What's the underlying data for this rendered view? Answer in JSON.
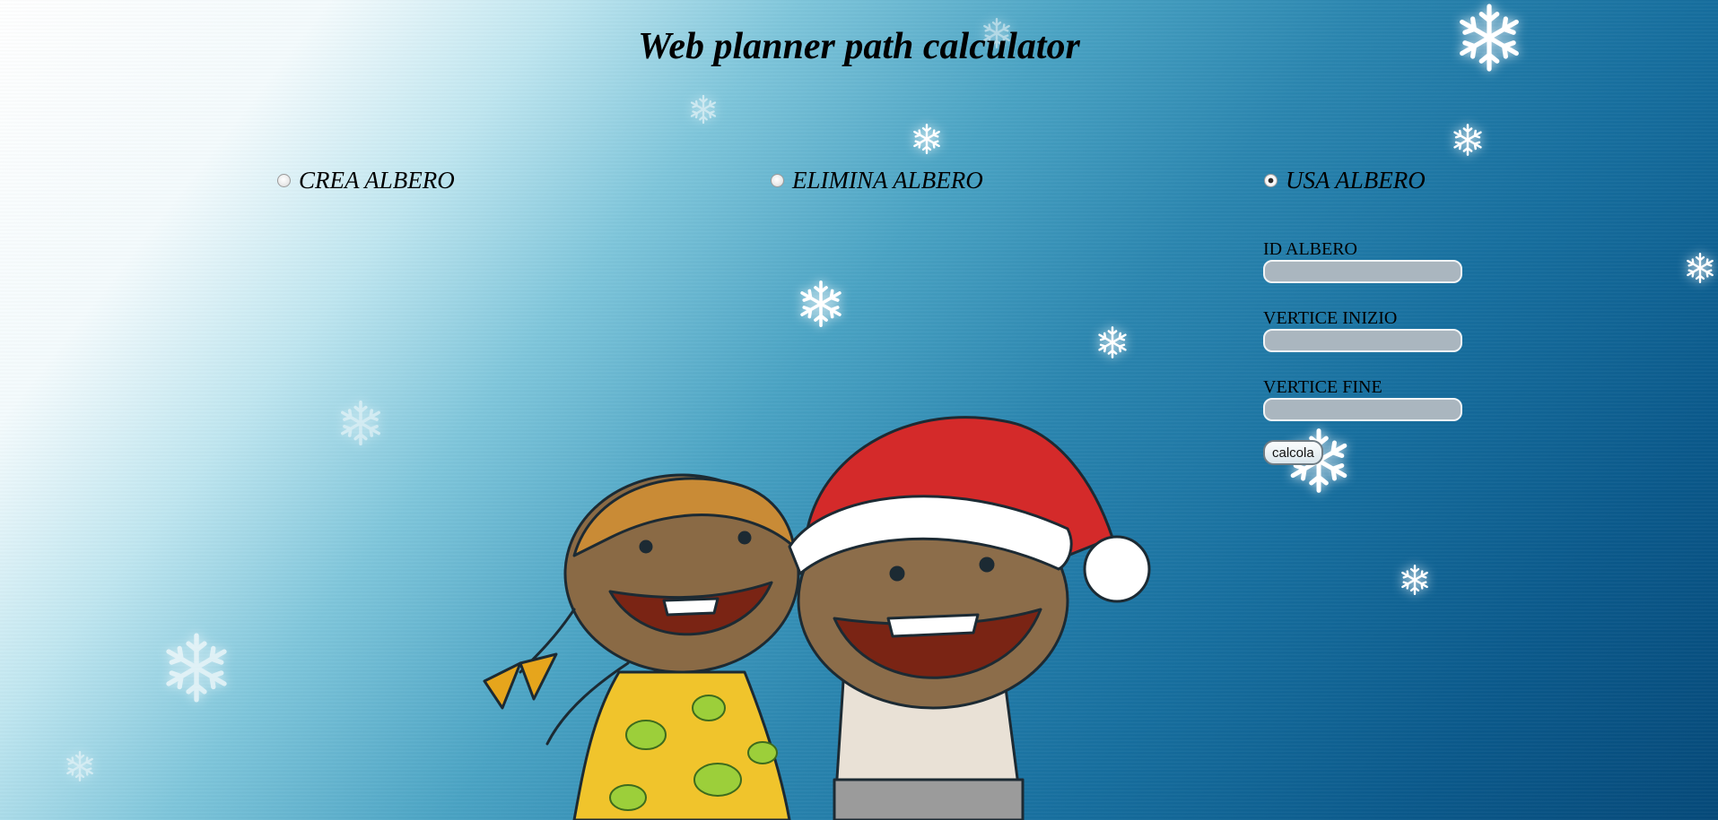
{
  "header": {
    "title": "Web planner path calculator"
  },
  "modes": [
    {
      "label": "CREA ALBERO",
      "value": "crea",
      "checked": false
    },
    {
      "label": "ELIMINA ALBERO",
      "value": "elimina",
      "checked": false
    },
    {
      "label": "USA ALBERO",
      "value": "usa",
      "checked": true
    }
  ],
  "form": {
    "id_label": "ID ALBERO",
    "id_value": "",
    "start_label": "VERTICE INIZIO",
    "start_value": "",
    "end_label": "VERTICE FINE",
    "end_value": "",
    "submit_label": "calcola"
  },
  "theme": {
    "background_light": "#ffffff",
    "background_dark": "#064a7a",
    "input_fill": "#aab6bf",
    "hat_red": "#d42a2a"
  },
  "icons": {
    "snowflake": "snowflake-icon",
    "illustration": "christmas-kids-illustration"
  }
}
